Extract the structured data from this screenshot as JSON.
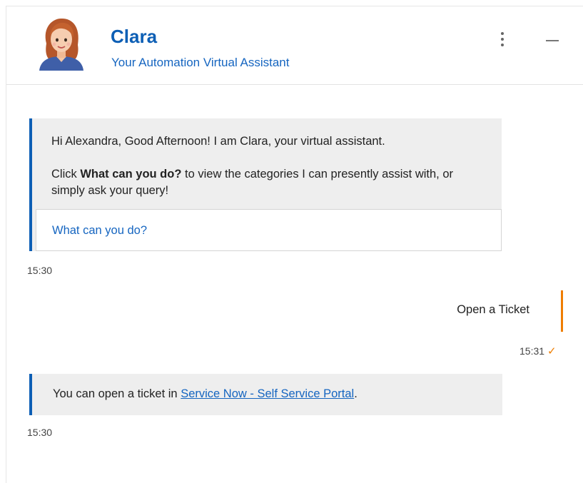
{
  "header": {
    "name": "Clara",
    "subtitle": "Your Automation Virtual Assistant",
    "menu_icon": "more-vertical-icon",
    "minimize_icon": "minimize-icon"
  },
  "messages": {
    "bot1": {
      "greeting": "Hi Alexandra, Good Afternoon! I am Clara, your virtual assistant.",
      "prompt_prefix": "Click ",
      "prompt_bold": "What can you do?",
      "prompt_suffix": " to view the categories I can presently assist with, or simply ask your query!",
      "quick_reply": "What can you do?",
      "time": "15:30"
    },
    "user1": {
      "text": "Open a Ticket",
      "time": "15:31",
      "status_icon": "check-icon"
    },
    "bot2": {
      "prefix": "You can open a ticket in ",
      "link_text": "Service Now - Self Service Portal",
      "suffix": ".",
      "time": "15:30"
    }
  },
  "colors": {
    "brand_blue": "#0d5fb5",
    "link_blue": "#1565c0",
    "user_accent": "#ef7d00",
    "bubble_bg": "#eeeeee"
  }
}
